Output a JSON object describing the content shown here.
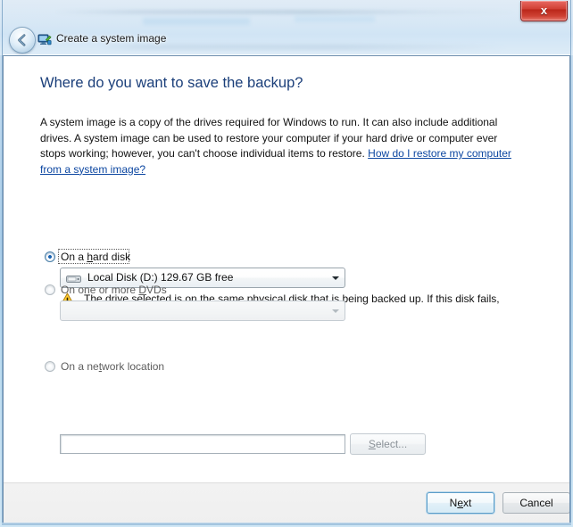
{
  "window": {
    "title": "Create a system image",
    "title_icon": "system-image-icon",
    "back_icon": "back-arrow-icon",
    "close_label": "x"
  },
  "page": {
    "heading": "Where do you want to save the backup?",
    "intro_part1": "A system image is a copy of the drives required for Windows to run. It can also include additional drives. A system image can be used to restore your computer if your hard drive or computer ever stops working; however, you can't choose individual items to restore. ",
    "intro_link": "How do I restore my computer from a system image?"
  },
  "options": {
    "hard_disk": {
      "label_pre": "On a ",
      "label_acc": "h",
      "label_post": "ard disk",
      "selected": true,
      "combo_value": "Local Disk (D:)  129.67 GB free",
      "drive_icon": "hard-drive-icon",
      "arrow_icon": "chevron-down-icon"
    },
    "dvd": {
      "label_pre": "On one or more ",
      "label_acc": "D",
      "label_post": "VDs",
      "selected": false,
      "combo_value": "",
      "arrow_icon": "chevron-down-icon",
      "disabled": true
    },
    "network": {
      "label_pre": "On a ne",
      "label_acc": "t",
      "label_post": "work location",
      "selected": false,
      "field_value": "",
      "field_placeholder": "",
      "select_pre": "",
      "select_acc": "S",
      "select_post": "elect...",
      "disabled": true
    }
  },
  "warning": {
    "icon": "warning-triangle-icon",
    "text": "The drive selected is on the same physical disk that is being backed up. If this disk fails, you will lose your backups."
  },
  "footer": {
    "next_pre": "N",
    "next_acc": "e",
    "next_post": "xt",
    "cancel_label": "Cancel"
  },
  "colors": {
    "heading": "#1b3f7a",
    "link": "#0d47a1",
    "close_red": "#ba2619",
    "default_button_border": "#5a9cc8",
    "warning_yellow": "#ffcc33"
  }
}
